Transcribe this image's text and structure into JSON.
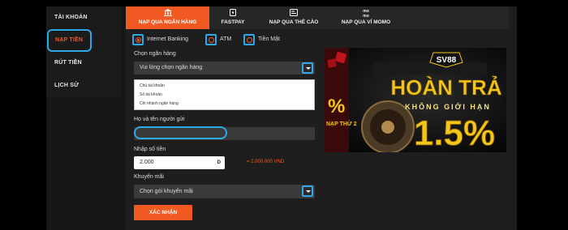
{
  "sidebar": {
    "items": [
      {
        "label": "TÀI KHOẢN"
      },
      {
        "label": "NẠP TIỀN"
      },
      {
        "label": "RÚT TIỀN"
      },
      {
        "label": "LỊCH SỬ"
      }
    ]
  },
  "tabs": [
    {
      "label": "NẠP QUA NGÂN HÀNG",
      "icon": "bank-icon"
    },
    {
      "label": "FASTPAY",
      "icon": "fastpay-icon"
    },
    {
      "label": "NẠP QUA THẺ CÀO",
      "icon": "card-icon"
    },
    {
      "label": "NẠP QUA VÍ MOMO",
      "icon": "momo-icon"
    }
  ],
  "momo_logo": "mo mo",
  "methods": [
    {
      "label": "Internet Banking",
      "selected": true
    },
    {
      "label": "ATM",
      "selected": false
    },
    {
      "label": "Tiền Mặt",
      "selected": false
    }
  ],
  "form": {
    "bank_label": "Chọn ngân hàng",
    "bank_placeholder": "Vui lòng chọn ngân hàng",
    "bank_list": [
      "Chủ tài khoản",
      "Số tài khoản",
      "Chi nhánh ngân hàng"
    ],
    "name_label": "Họ và tên người gửi",
    "name_value": "",
    "amount_label": "Nhập số tiền",
    "amount_value": "2.000",
    "amount_suffix": "D",
    "amount_converted": "= 2.000.000 VND",
    "promo_label": "Khuyến mãi",
    "promo_value": "Chọn gói khuyến mãi",
    "submit_label": "XÁC NHẬN"
  },
  "banner": {
    "brand": "SV88",
    "headline": "HOÀN TRẢ",
    "subline": "KHÔNG GIỚI HẠN",
    "percent": "1.5%",
    "side_text": "NẠP THỨ 2",
    "side_percent": "%"
  },
  "colors": {
    "accent": "#f05a22",
    "highlight": "#2ea8e6",
    "banner_gold": "#f5c518"
  }
}
